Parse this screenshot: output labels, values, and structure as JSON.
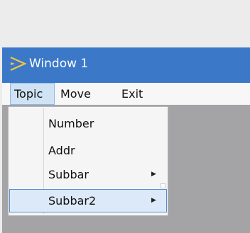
{
  "window": {
    "title": "Window 1",
    "logo_icon": "yellow-arrow-logo-icon",
    "colors": {
      "titlebar": "#3b78c8",
      "body": "#a4a3a6",
      "logo": "#f5c542"
    }
  },
  "menubar": {
    "items": [
      {
        "label": "Topic",
        "active": true
      },
      {
        "label": "Move",
        "active": false
      },
      {
        "label": "Exit",
        "active": false
      }
    ]
  },
  "dropdown": {
    "items": [
      {
        "label": "Number",
        "has_submenu": false,
        "highlighted": false
      },
      {
        "label": "Addr",
        "has_submenu": false,
        "highlighted": false
      },
      {
        "label": "Subbar",
        "has_submenu": true,
        "highlighted": false,
        "arrow_icon": "submenu-arrow-icon"
      },
      {
        "label": "Subbar2",
        "has_submenu": true,
        "highlighted": true,
        "arrow_icon": "submenu-arrow-icon"
      }
    ]
  }
}
